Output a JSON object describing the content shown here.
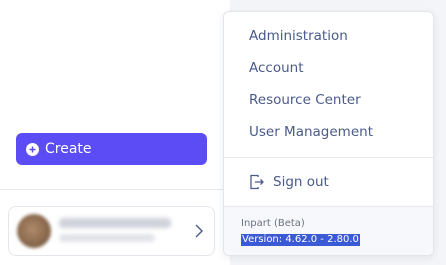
{
  "sidebar": {
    "create_label": "Create"
  },
  "account_menu": {
    "items": [
      {
        "label": "Administration"
      },
      {
        "label": "Account"
      },
      {
        "label": "Resource Center"
      },
      {
        "label": "User Management"
      }
    ],
    "sign_out_label": "Sign out",
    "app_name": "Inpart (Beta)",
    "version": "Version: 4.62.0 - 2.80.0"
  },
  "colors": {
    "accent": "#5b4cf5",
    "menu_text": "#4a5a8a",
    "selection": "#3b5bd6"
  }
}
